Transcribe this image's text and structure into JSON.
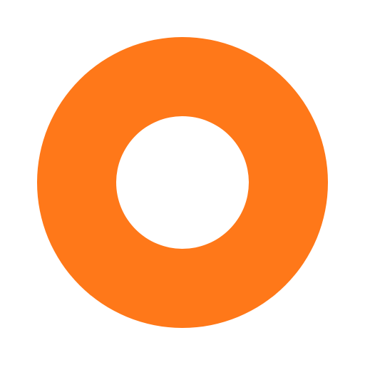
{
  "icon": {
    "name": "ring-icon",
    "color": "#ff7819",
    "background": "#ffffff"
  }
}
